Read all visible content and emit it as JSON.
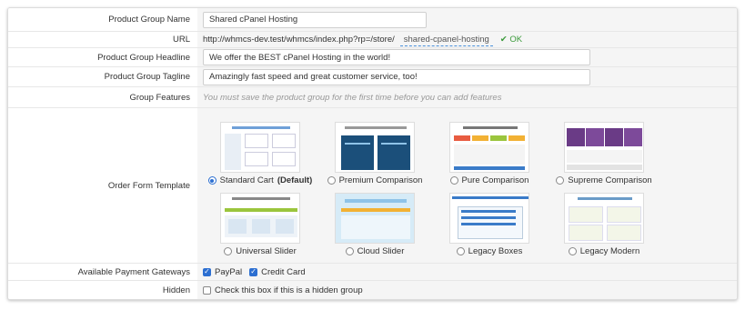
{
  "fields": {
    "group_name": {
      "label": "Product Group Name",
      "value": "Shared cPanel Hosting"
    },
    "url": {
      "label": "URL",
      "prefix": "http://whmcs-dev.test/whmcs/index.php?rp=/store/",
      "slug": "shared-cpanel-hosting",
      "status": "✔ OK"
    },
    "headline": {
      "label": "Product Group Headline",
      "value": "We offer the BEST cPanel Hosting in the world!"
    },
    "tagline": {
      "label": "Product Group Tagline",
      "value": "Amazingly fast speed and great customer service, too!"
    },
    "features": {
      "label": "Group Features",
      "hint": "You must save the product group for the first time before you can add features"
    },
    "template": {
      "label": "Order Form Template"
    },
    "gateways": {
      "label": "Available Payment Gateways",
      "options": [
        "PayPal",
        "Credit Card"
      ]
    },
    "hidden": {
      "label": "Hidden",
      "text": "Check this box if this is a hidden group"
    }
  },
  "templates": [
    {
      "name": "Standard Cart",
      "suffix": "(Default)",
      "selected": true
    },
    {
      "name": "Premium Comparison",
      "suffix": "",
      "selected": false
    },
    {
      "name": "Pure Comparison",
      "suffix": "",
      "selected": false
    },
    {
      "name": "Supreme Comparison",
      "suffix": "",
      "selected": false
    },
    {
      "name": "Universal Slider",
      "suffix": "",
      "selected": false
    },
    {
      "name": "Cloud Slider",
      "suffix": "",
      "selected": false
    },
    {
      "name": "Legacy Boxes",
      "suffix": "",
      "selected": false
    },
    {
      "name": "Legacy Modern",
      "suffix": "",
      "selected": false
    }
  ],
  "colors": {
    "accent": "#2c6fd1",
    "ok": "#3c9b3c",
    "premium": "#1b4f7a",
    "supreme": "#6a3b86"
  }
}
